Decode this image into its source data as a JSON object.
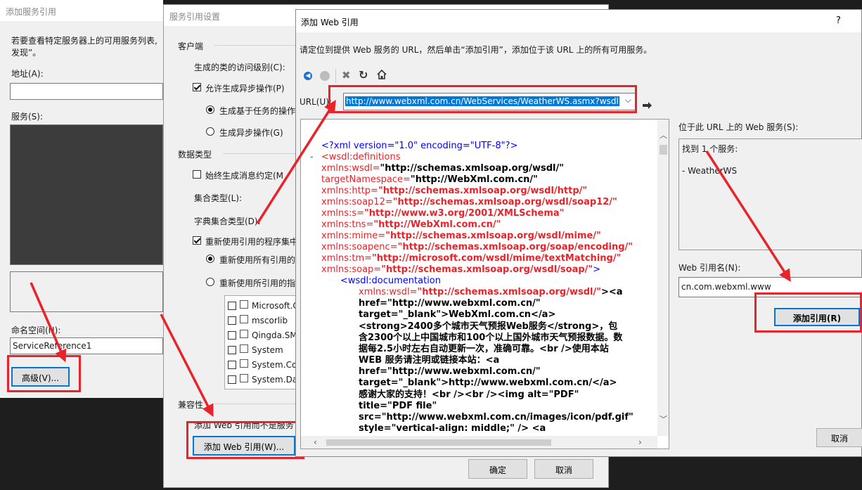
{
  "win1": {
    "title": "添加服务引用",
    "instruction_line1": "若要查看特定服务器上的可用服务列表,",
    "instruction_line2": "发现”。",
    "address_label": "地址(A):",
    "address_value": "",
    "services_label": "服务(S):",
    "namespace_label": "命名空间(N):",
    "namespace_value": "ServiceReference1",
    "advanced_button": "高级(V)..."
  },
  "win2": {
    "title": "服务引用设置",
    "client_group": "客户端",
    "access_level_label": "生成的类的访问级别(C):",
    "allow_async_label": "允许生成异步操作(P)",
    "task_based_label": "生成基于任务的操作",
    "async_ops_label": "生成异步操作(G)",
    "data_type_group": "数据类型",
    "always_gen_label": "始终生成消息约定(M",
    "collection_label": "集合类型(L):",
    "dict_collection_label": "字典集合类型(D):",
    "reuse_types_label": "重新使用引用的程序集中",
    "reuse_all_label": "重新使用所有引用的",
    "reuse_specified_label": "重新使用所引用的指",
    "assemblies": [
      "Microsoft.C",
      "mscorlib",
      "Qingda.SM",
      "System",
      "System.Co",
      "System.Da"
    ],
    "compat_group": "兼容性",
    "compat_desc": "添加 Web 引用而不是服务",
    "add_web_ref_button": "添加 Web 引用(W)...",
    "ok_button": "确定",
    "cancel_button": "取消"
  },
  "win3": {
    "title": "添加 Web 引用",
    "help": "?",
    "instruction": "请定位到提供 Web 服务的 URL，然后单击“添加引用”，添加位于该 URL 上的所有可用服务。",
    "url_label": "URL(U):",
    "url_value": "http://www.webxml.com.cn/WebServices/WeatherWS.asmx?wsdl",
    "services_at_url_label": "位于此 URL 上的 Web 服务(S):",
    "found_text": "找到 1 个服务:",
    "service_item": "- WeatherWS",
    "ref_name_label": "Web 引用名(N):",
    "ref_name_value": "cn.com.webxml.www",
    "add_ref_button": "添加引用(R)",
    "cancel_button": "取消"
  },
  "xml": {
    "line_decl": "<?xml version=\"1.0\" encoding=\"UTF-8\"?>",
    "collapse_marker": "-",
    "defs_open": "<wsdl:definitions",
    "attrs": [
      {
        "name": "xmlns:wsdl=",
        "value": "\"http://schemas.xmlsoap.org/wsdl/\""
      },
      {
        "name": "targetNamespace=",
        "value": "\"http://WebXml.com.cn/\""
      },
      {
        "name": "xmlns:http=",
        "value": "\"http://schemas.xmlsoap.org/wsdl/http/\""
      },
      {
        "name": "xmlns:soap12=",
        "value": "\"http://schemas.xmlsoap.org/wsdl/soap12/\""
      },
      {
        "name": "xmlns:s=",
        "value": "\"http://www.w3.org/2001/XMLSchema\""
      },
      {
        "name": "xmlns:tns=",
        "value": "\"http://WebXml.com.cn/\""
      },
      {
        "name": "xmlns:mime=",
        "value": "\"http://schemas.xmlsoap.org/wsdl/mime/\""
      },
      {
        "name": "xmlns:soapenc=",
        "value": "\"http://schemas.xmlsoap.org/soap/encoding/\""
      },
      {
        "name": "xmlns:tm=",
        "value": "\"http://microsoft.com/wsdl/mime/textMatching/\""
      },
      {
        "name": "xmlns:soap=",
        "value": "\"http://schemas.xmlsoap.org/wsdl/soap/\"",
        "suffix": ">"
      }
    ],
    "doc_open": "<wsdl:documentation",
    "doc_attr_name": "xmlns:wsdl=",
    "doc_attr_value": "\"http://schemas.xmlsoap.org/wsdl/\"",
    "doc_attr_suffix": "><a",
    "content_lines": [
      "href=\"http://www.webxml.com.cn/\"",
      "target=\"_blank\">WebXml.com.cn</a>",
      "<strong>2400多个城市天气预报Web服务</strong>，包",
      "含2300个以上中国城市和100个以上国外城市天气预报数据。数",
      "据每2.5小时左右自动更新一次，准确可靠。<br />使用本站",
      "WEB 服务请注明或链接本站：<a",
      "href=\"http://www.webxml.com.cn/\"",
      "target=\"_blank\">http://www.webxml.com.cn/</a>",
      "感谢大家的支持！<br /><br /><img alt=\"PDF\"",
      "title=\"PDF file\"",
      "src=\"http://www.webxml.com.cn/images/icon/pdf.gif\"",
      "style=\"vertical-align: middle;\" /> <a"
    ]
  },
  "colors": {
    "annotation": "#e8232a",
    "xml_blue": "#0000ff",
    "dark_bg": "#1e1e1e"
  }
}
